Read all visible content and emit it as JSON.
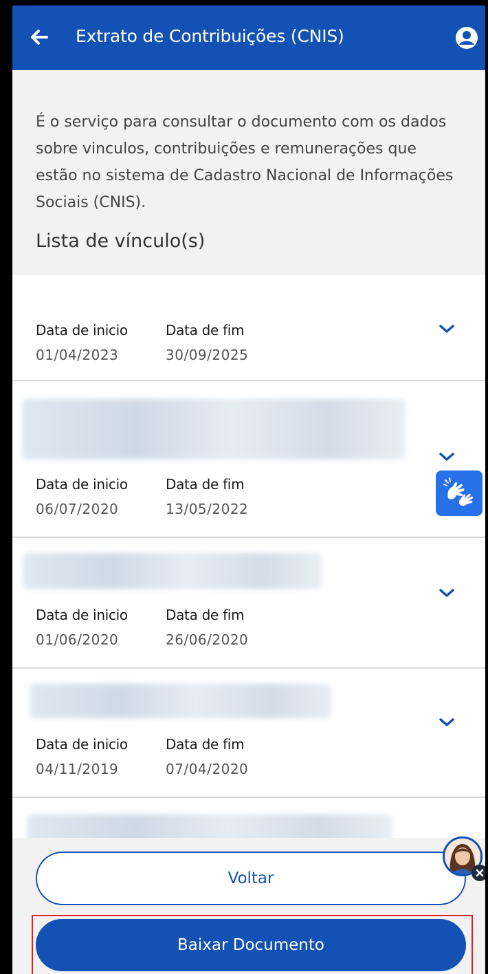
{
  "header": {
    "title": "Extrato de Contribuições (CNIS)"
  },
  "intro": {
    "text": "É o serviço para consultar o documento com os dados sobre vinculos, contribuições e remunerações que estão no sistema de Cadastro Nacional de Informações Sociais (CNIS)."
  },
  "list": {
    "heading": "Lista de vínculo(s)",
    "items": [
      {
        "start_label": "Data de inicio",
        "end_label": "Data de fim",
        "start": "01/04/2023",
        "end": "30/09/2025"
      },
      {
        "start_label": "Data de inicio",
        "end_label": "Data de fim",
        "start": "06/07/2020",
        "end": "13/05/2022"
      },
      {
        "start_label": "Data de inicio",
        "end_label": "Data de fim",
        "start": "01/06/2020",
        "end": "26/06/2020"
      },
      {
        "start_label": "Data de inicio",
        "end_label": "Data de fim",
        "start": "04/11/2019",
        "end": "07/04/2020"
      }
    ]
  },
  "buttons": {
    "voltar": "Voltar",
    "baixar": "Baixar Documento"
  },
  "icons": {
    "back": "arrow-left-icon",
    "user": "user-circle-icon",
    "expand": "chevron-down-icon",
    "libras": "sign-language-icon",
    "assistant": "assistant-avatar",
    "close": "close-icon"
  },
  "colors": {
    "primary": "#1351b4",
    "libras": "#2670e8",
    "highlight": "#e02020",
    "background": "#f2f2f2"
  }
}
